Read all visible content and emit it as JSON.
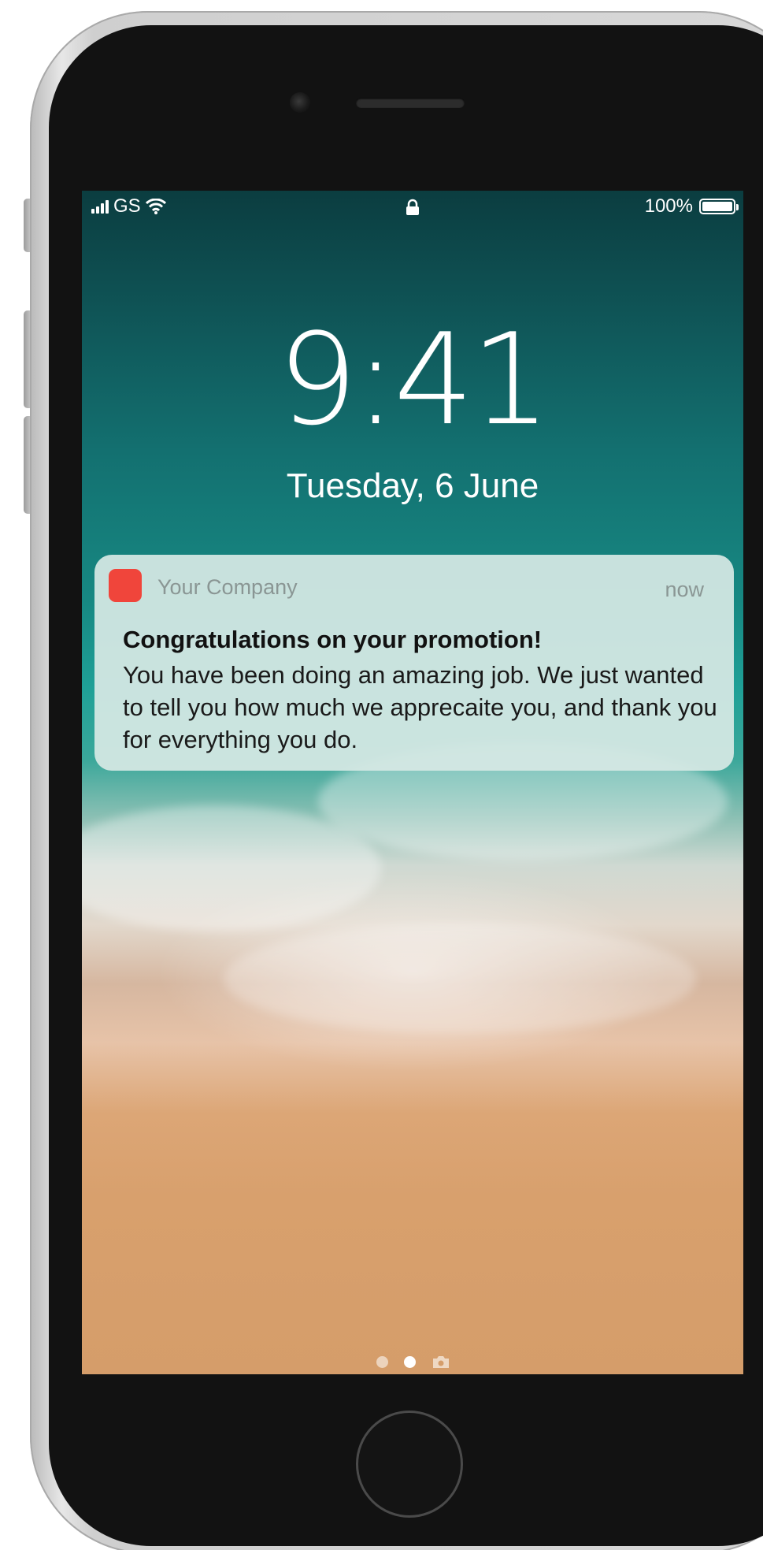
{
  "status_bar": {
    "carrier": "GS",
    "battery_percent": "100%",
    "battery_level": 1.0,
    "icons": [
      "signal-icon",
      "wifi-icon",
      "lock-icon",
      "battery-icon"
    ]
  },
  "lock_screen": {
    "time": "9:41",
    "date": "Tuesday, 6 June"
  },
  "notification": {
    "app_name": "Your Company",
    "app_icon": "app-icon",
    "app_icon_color": "#f0453b",
    "time": "now",
    "title": "Congratulations on your promotion!",
    "body": "You have been doing an amazing job. We just wanted to tell you how much we apprecaite you, and thank you for everything you do."
  },
  "page_indicator": {
    "pages": 3,
    "active_index": 1,
    "last_icon": "camera-icon"
  },
  "device": {
    "icons": [
      "front-camera",
      "speaker",
      "home-button"
    ]
  }
}
